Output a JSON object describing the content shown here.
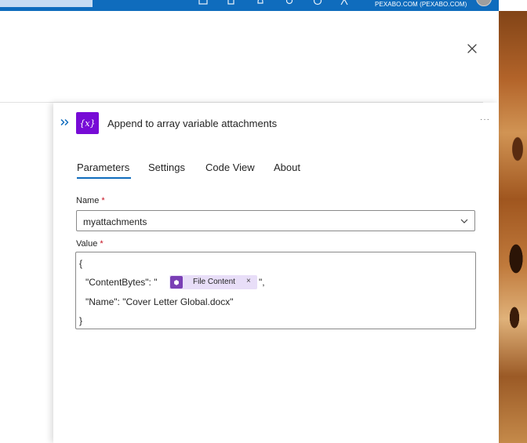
{
  "header": {
    "account": "PEXABO.COM (PEXABO.COM)"
  },
  "action": {
    "title": "Append to array variable attachments",
    "icon_text": "{x}",
    "more": "···"
  },
  "tabs": [
    {
      "label": "Parameters",
      "selected": true
    },
    {
      "label": "Settings"
    },
    {
      "label": "Code View"
    },
    {
      "label": "About"
    }
  ],
  "fields": {
    "name": {
      "label": "Name",
      "required_mark": "*",
      "value": "myattachments"
    },
    "value": {
      "label": "Value",
      "required_mark": "*",
      "lines": [
        "{",
        "\"ContentBytes\": \"",
        "\",",
        "\"Name\": \"Cover Letter Global.docx\"",
        "}"
      ],
      "token": {
        "label": "File Content",
        "remove": "×"
      }
    }
  },
  "colors": {
    "accent": "#0f6cbd",
    "variable_icon": "#770bd6",
    "token_bg": "#e8def8",
    "required": "#c50f1f"
  },
  "icons": {
    "close": "close-icon",
    "expand": "chevron-double-right-icon",
    "dropdown": "chevron-down-icon",
    "more": "more-icon"
  }
}
